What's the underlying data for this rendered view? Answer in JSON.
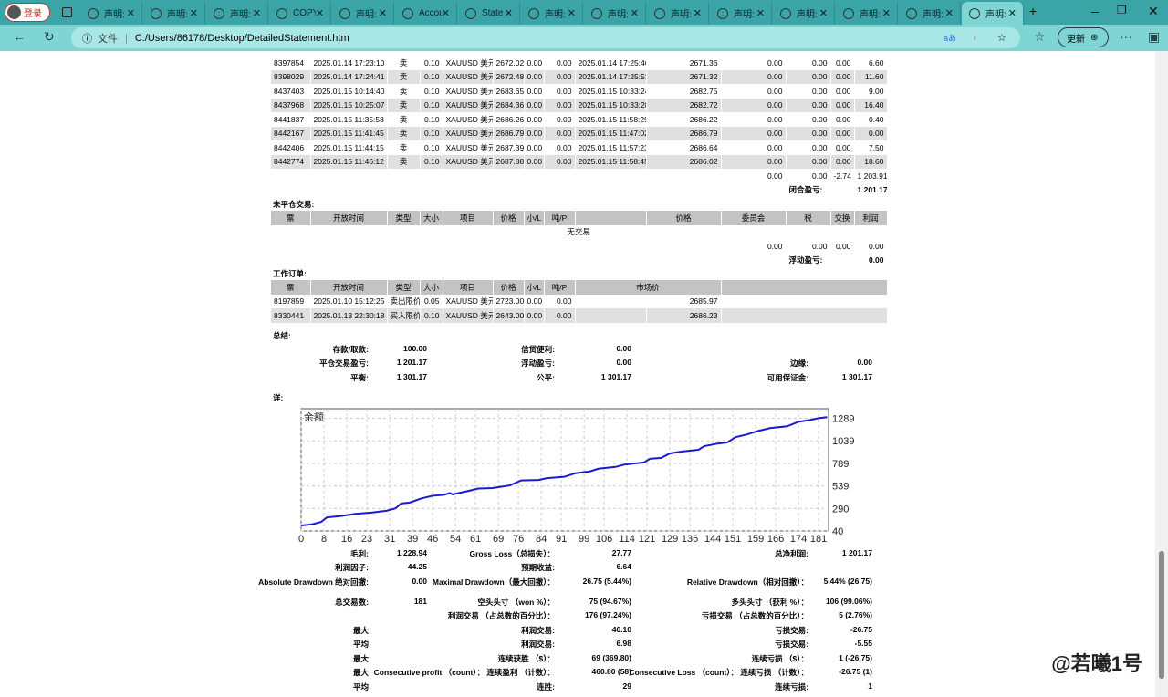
{
  "browser": {
    "login": "登录",
    "tabs": [
      "声明:",
      "声明:",
      "声明:",
      "COPY",
      "声明:",
      "Accou",
      "State",
      "声明:",
      "声明:",
      "声明:",
      "声明:",
      "声明:",
      "声明:",
      "声明:",
      "声明:"
    ],
    "active_tab": 14,
    "file_label": "文件",
    "url": "C:/Users/86178/Desktop/DetailedStatement.htm",
    "update_label": "更新"
  },
  "closed": {
    "rows": [
      [
        "8397854",
        "2025.01.14 17:23:10",
        "卖",
        "0.10",
        "XAUUSD 美元",
        "2672.02",
        "0.00",
        "0.00",
        "2025.01.14 17:25:46",
        "2671.36",
        "0.00",
        "0.00",
        "0.00",
        "6.60"
      ],
      [
        "8398029",
        "2025.01.14 17:24:41",
        "卖",
        "0.10",
        "XAUUSD 美元",
        "2672.48",
        "0.00",
        "0.00",
        "2025.01.14 17:25:53",
        "2671.32",
        "0.00",
        "0.00",
        "0.00",
        "11.60"
      ],
      [
        "8437403",
        "2025.01.15 10:14:40",
        "卖",
        "0.10",
        "XAUUSD 美元",
        "2683.65",
        "0.00",
        "0.00",
        "2025.01.15 10:33:24",
        "2682.75",
        "0.00",
        "0.00",
        "0.00",
        "9.00"
      ],
      [
        "8437968",
        "2025.01.15 10:25:07",
        "卖",
        "0.10",
        "XAUUSD 美元",
        "2684.36",
        "0.00",
        "0.00",
        "2025.01.15 10:33:28",
        "2682.72",
        "0.00",
        "0.00",
        "0.00",
        "16.40"
      ],
      [
        "8441837",
        "2025.01.15 11:35:58",
        "卖",
        "0.10",
        "XAUUSD 美元",
        "2686.26",
        "0.00",
        "0.00",
        "2025.01.15 11:58:29",
        "2686.22",
        "0.00",
        "0.00",
        "0.00",
        "0.40"
      ],
      [
        "8442167",
        "2025.01.15 11:41:45",
        "卖",
        "0.10",
        "XAUUSD 美元",
        "2686.79",
        "0.00",
        "0.00",
        "2025.01.15 11:47:02",
        "2686.79",
        "0.00",
        "0.00",
        "0.00",
        "0.00"
      ],
      [
        "8442406",
        "2025.01.15 11:44:15",
        "卖",
        "0.10",
        "XAUUSD 美元",
        "2687.39",
        "0.00",
        "0.00",
        "2025.01.15 11:57:23",
        "2686.64",
        "0.00",
        "0.00",
        "0.00",
        "7.50"
      ],
      [
        "8442774",
        "2025.01.15 11:46:12",
        "卖",
        "0.10",
        "XAUUSD 美元",
        "2687.88",
        "0.00",
        "0.00",
        "2025.01.15 11:58:45",
        "2686.02",
        "0.00",
        "0.00",
        "0.00",
        "18.60"
      ]
    ],
    "totals": [
      "0.00",
      "0.00",
      "-2.74",
      "1 203.91"
    ],
    "pl_label": "闭合盈亏:",
    "pl_value": "1 201.17"
  },
  "open": {
    "title": "未平仓交易:",
    "headers": [
      "票",
      "开放时间",
      "类型",
      "大小",
      "项目",
      "价格",
      "小/L",
      "吨/P",
      "",
      "价格",
      "委员会",
      "税",
      "交换",
      "利润"
    ],
    "empty": "无交易",
    "totals": [
      "0.00",
      "0.00",
      "0.00",
      "0.00"
    ],
    "fl_label": "浮动盈亏:",
    "fl_value": "0.00"
  },
  "orders": {
    "title": "工作订单:",
    "headers": [
      "票",
      "开放时间",
      "类型",
      "大小",
      "项目",
      "价格",
      "小/L",
      "吨/P",
      "市场价",
      ""
    ],
    "rows": [
      [
        "8197859",
        "2025.01.10 15:12:25",
        "卖出限价",
        "0.05",
        "XAUUSD 美元",
        "2723.00",
        "0.00",
        "0.00",
        "2685.97"
      ],
      [
        "8330441",
        "2025.01.13 22:30:18",
        "买入限价",
        "0.10",
        "XAUUSD 美元",
        "2643.00",
        "0.00",
        "0.00",
        "2686.23"
      ]
    ]
  },
  "summary": {
    "title": "总结:",
    "rows": [
      [
        "存款/取款:",
        "100.00",
        "信贷便利:",
        "0.00",
        "",
        ""
      ],
      [
        "平仓交易盈亏:",
        "1 201.17",
        "浮动盈亏:",
        "0.00",
        "边缘:",
        "0.00"
      ],
      [
        "平衡:",
        "1 301.17",
        "公平:",
        "1 301.17",
        "可用保证金:",
        "1 301.17"
      ]
    ]
  },
  "details": {
    "title": "详:",
    "rows": [
      [
        "毛利:",
        "1 228.94",
        "Gross Loss（总损失）：",
        "27.77",
        "总净利润:",
        "1 201.17"
      ],
      [
        "利润因子:",
        "44.25",
        "预期收益:",
        "6.64",
        "",
        ""
      ],
      [
        "Absolute Drawdown 绝对回撤:",
        "0.00",
        "Maximal Drawdown（最大回撤）：",
        "26.75 (5.44%)",
        "Relative Drawdown（相对回撤）：",
        "5.44% (26.75)"
      ],
      [
        "总交易数:",
        "181",
        "空头头寸 （won %）：",
        "75 (94.67%)",
        "多头头寸 （获利 %）：",
        "106 (99.06%)"
      ],
      [
        "",
        "",
        "利润交易 （占总数的百分比）：",
        "176 (97.24%)",
        "亏损交易 （占总数的百分比）：",
        "5 (2.76%)"
      ],
      [
        "最大",
        "",
        "利润交易:",
        "40.10",
        "亏损交易:",
        "-26.75"
      ],
      [
        "平均",
        "",
        "利润交易:",
        "6.98",
        "亏损交易:",
        "-5.55"
      ],
      [
        "最大",
        "",
        "连续获胜 （$）：",
        "69 (369.80)",
        "连续亏损 （$）：",
        "1 (-26.75)"
      ],
      [
        "最大",
        "",
        "Consecutive profit （count）： 连续盈利 （计数）：",
        "460.80 (58)",
        "Consecutive Loss （count）： 连续亏损 （计数）：",
        "-26.75 (1)"
      ],
      [
        "平均",
        "",
        "连胜:",
        "29",
        "连续亏损:",
        "1"
      ]
    ]
  },
  "chart_data": {
    "type": "line",
    "title": "余额",
    "x_ticks": [
      0,
      8,
      16,
      23,
      31,
      39,
      46,
      54,
      61,
      69,
      76,
      84,
      91,
      99,
      106,
      114,
      121,
      129,
      136,
      144,
      151,
      159,
      166,
      174,
      181
    ],
    "y_ticks": [
      40,
      290,
      539,
      789,
      1039,
      1289
    ],
    "xlim": [
      0,
      184.5
    ],
    "ylim": [
      40,
      1395
    ],
    "series": [
      {
        "name": "余额",
        "x": [
          0,
          4,
          7,
          9,
          14,
          19,
          25,
          30,
          33,
          35,
          38,
          42,
          46,
          50,
          52,
          53,
          58,
          62,
          67,
          70,
          73,
          77,
          83,
          86,
          92,
          96,
          101,
          104,
          110,
          113,
          120,
          122,
          126,
          129,
          133,
          139,
          141,
          146,
          149,
          152,
          156,
          160,
          164,
          170,
          174,
          178,
          181,
          184
        ],
        "y": [
          100,
          115,
          140,
          190,
          205,
          230,
          245,
          265,
          290,
          345,
          355,
          400,
          430,
          440,
          460,
          445,
          480,
          510,
          515,
          530,
          545,
          600,
          605,
          625,
          640,
          680,
          700,
          730,
          750,
          775,
          800,
          840,
          850,
          900,
          920,
          940,
          980,
          1010,
          1020,
          1080,
          1110,
          1150,
          1180,
          1200,
          1250,
          1270,
          1290,
          1301
        ]
      }
    ],
    "color": "#1a1acc"
  },
  "watermark": "@若曦1号"
}
